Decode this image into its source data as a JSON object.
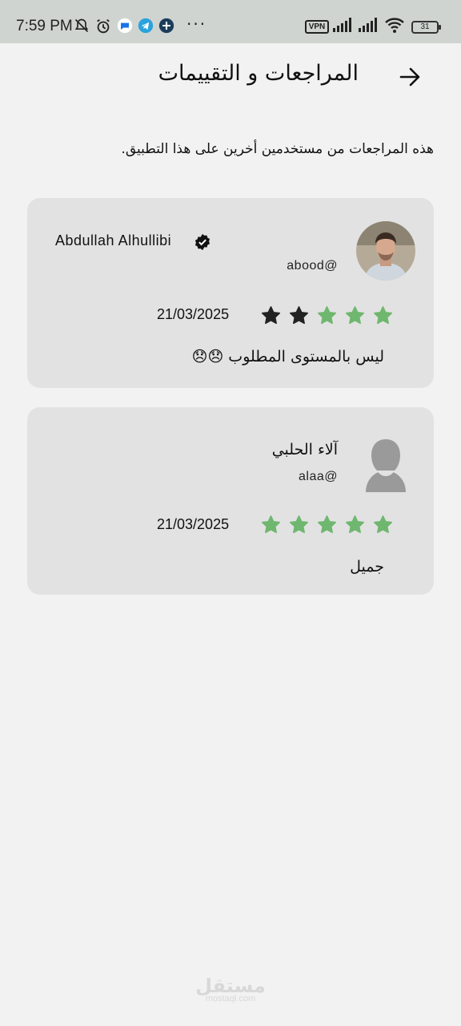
{
  "status_bar": {
    "time": "7:59 PM",
    "vpn_label": "VPN",
    "battery_level": "31",
    "more_dots": "···"
  },
  "header": {
    "title": "المراجعات و التقييمات",
    "back_icon": "arrow-right-icon"
  },
  "subtitle": "هذه المراجعات من مستخدمين أخرين على هذا التطبيق.",
  "reviews": [
    {
      "name": "Abdullah Alhullibi",
      "handle": "abood@",
      "verified": true,
      "avatar": "user-photo",
      "rating": 3,
      "max_rating": 5,
      "date": "21/03/2025",
      "comment": "ليس بالمستوى المطلوب 😞😞"
    },
    {
      "name": "آلاء الحلبي",
      "handle": "alaa@",
      "verified": false,
      "avatar": "default-person-icon",
      "rating": 5,
      "max_rating": 5,
      "date": "21/03/2025",
      "comment": "جميل"
    }
  ],
  "colors": {
    "star_filled": "#6fb76f",
    "star_empty": "#222222",
    "card_bg": "#e2e2e2",
    "page_bg": "#f2f2f2"
  },
  "watermark": {
    "main": "مستقل",
    "sub": "mostaql.com"
  }
}
